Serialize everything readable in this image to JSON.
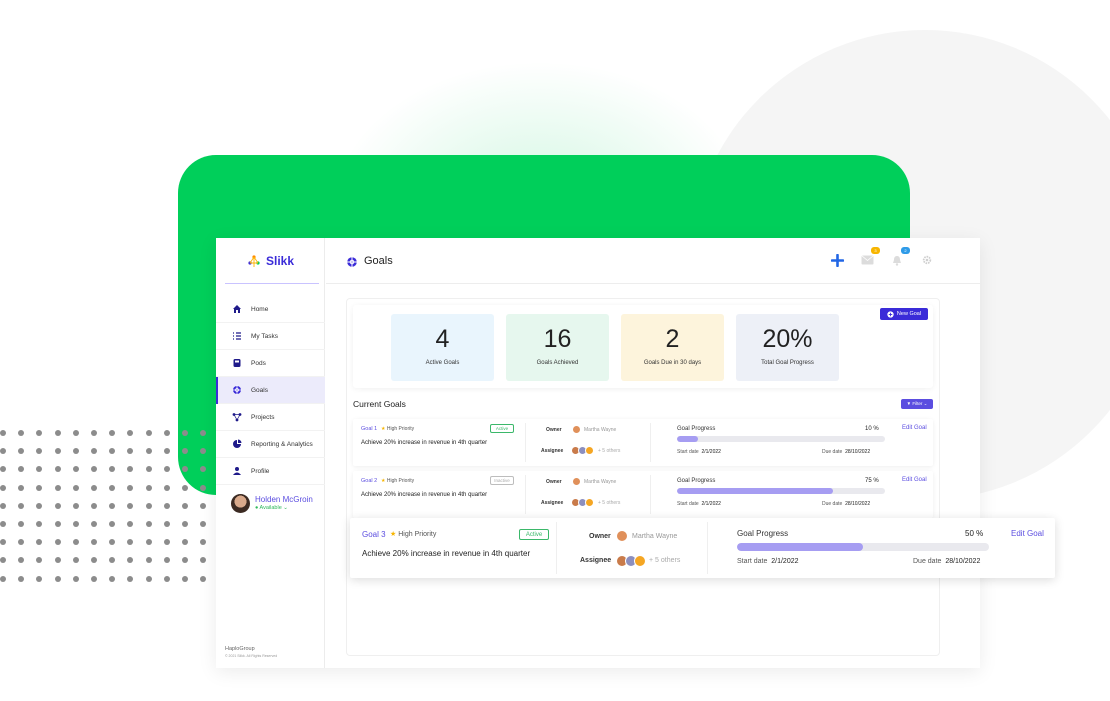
{
  "app": {
    "brand": "Slikk",
    "page_title": "Goals"
  },
  "sidebar": {
    "items": [
      {
        "label": "Home"
      },
      {
        "label": "My Tasks"
      },
      {
        "label": "Pods"
      },
      {
        "label": "Goals"
      },
      {
        "label": "Projects"
      },
      {
        "label": "Reporting & Analytics"
      },
      {
        "label": "Profile"
      }
    ],
    "user": {
      "name": "Holden McGroin",
      "status": "Available ⌄"
    },
    "footer": {
      "org": "HaploGroup",
      "copyright": "© 2021 Slikk. All Rights Reserved"
    }
  },
  "topbar": {
    "mail_badge": "3",
    "bell_badge": "2"
  },
  "stats": [
    {
      "value": "4",
      "label": "Active Goals",
      "color": "#e9f5fd"
    },
    {
      "value": "16",
      "label": "Goals Achieved",
      "color": "#e6f7ee"
    },
    {
      "value": "2",
      "label": "Goals Due in 30 days",
      "color": "#fdf4dc"
    },
    {
      "value": "20%",
      "label": "Total Goal Progress",
      "color": "#edf0f7"
    }
  ],
  "new_goal_label": "New Goal",
  "current_goals_title": "Current Goals",
  "filter_label": "▼ Filter ⌄",
  "goals": [
    {
      "name": "Goal 1",
      "priority": "High Priority",
      "status": "Active",
      "description": "Achieve 20% increase in revenue in 4th quarter",
      "owner_label": "Owner",
      "owner": "Martha Wayne",
      "assignee_label": "Assignee",
      "others": "+ 5 others",
      "progress_label": "Goal Progress",
      "progress": 10,
      "progress_text": "10 %",
      "start_label": "Start date",
      "start": "2/1/2022",
      "due_label": "Due date",
      "due": "28/10/2022",
      "edit": "Edit Goal"
    },
    {
      "name": "Goal 2",
      "priority": "High Priority",
      "status": "Inactive",
      "description": "Achieve 20% increase in revenue in 4th quarter",
      "owner_label": "Owner",
      "owner": "Martha Wayne",
      "assignee_label": "Assignee",
      "others": "+ 5 others",
      "progress_label": "Goal Progress",
      "progress": 75,
      "progress_text": "75 %",
      "start_label": "Start date",
      "start": "2/1/2022",
      "due_label": "Due date",
      "due": "28/10/2022",
      "edit": "Edit Goal"
    },
    {
      "name": "Goal 3",
      "priority": "High Priority",
      "status": "Active",
      "description": "Achieve 20% increase in revenue in 4th quarter",
      "owner_label": "Owner",
      "owner": "Martha Wayne",
      "assignee_label": "Assignee",
      "others": "+ 5 others",
      "progress_label": "Goal Progress",
      "progress": 50,
      "progress_text": "50 %",
      "start_label": "Start date",
      "start": "2/1/2022",
      "due_label": "Due date",
      "due": "28/10/2022",
      "edit": "Edit Goal"
    }
  ],
  "colors": {
    "accent": "#3a2bd8",
    "green": "#00cf5a",
    "progress": "#a69df2"
  }
}
